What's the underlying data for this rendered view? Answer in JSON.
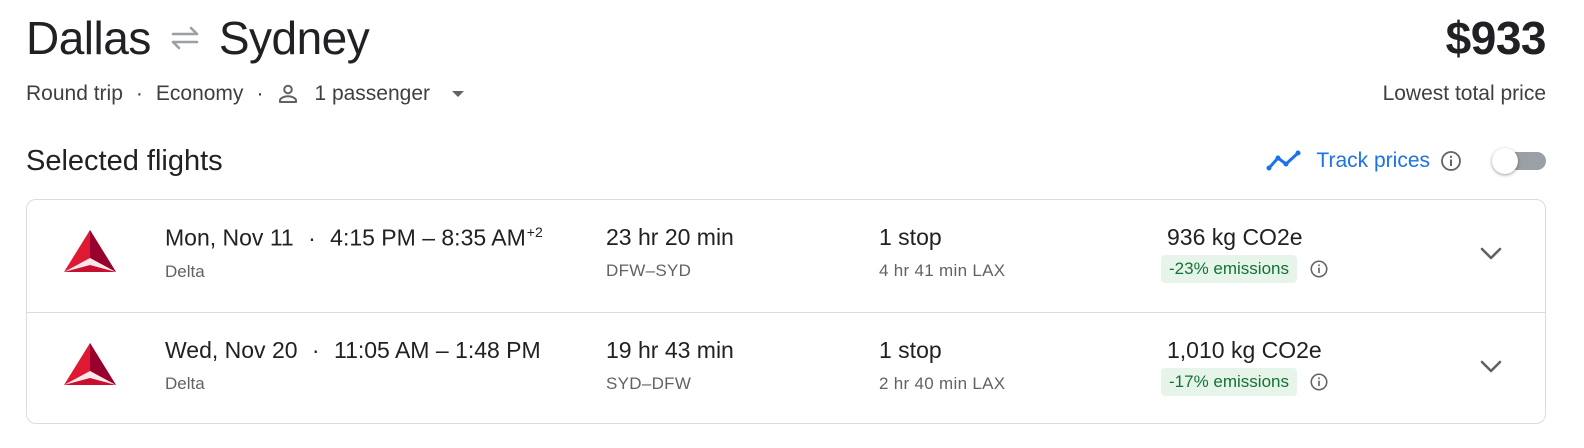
{
  "trip": {
    "origin": "Dallas",
    "destination": "Sydney",
    "price": "$933",
    "price_label": "Lowest total price",
    "trip_type": "Round trip",
    "cabin": "Economy",
    "passengers": "1 passenger",
    "separator": "·"
  },
  "section": {
    "title": "Selected flights",
    "track_label": "Track prices",
    "track_enabled": false
  },
  "flights": [
    {
      "date": "Mon, Nov 11",
      "separator": "·",
      "time_range": "4:15 PM – 8:35 AM",
      "day_offset": "+2",
      "airline": "Delta",
      "duration": "23 hr 20 min",
      "route": "DFW–SYD",
      "stops": "1 stop",
      "layover": "4 hr 41 min LAX",
      "co2": "936 kg CO2e",
      "emissions": "-23% emissions"
    },
    {
      "date": "Wed, Nov 20",
      "separator": "·",
      "time_range": "11:05 AM – 1:48 PM",
      "day_offset": "",
      "airline": "Delta",
      "duration": "19 hr 43 min",
      "route": "SYD–DFW",
      "stops": "1 stop",
      "layover": "2 hr 40 min LAX",
      "co2": "1,010 kg CO2e",
      "emissions": "-17% emissions"
    }
  ],
  "colors": {
    "accent": "#1a73e8",
    "emission_text": "#137333",
    "emission_bg": "#e6f4ea",
    "delta_red": "#e01933",
    "delta_dark": "#98002e"
  },
  "icons": {
    "swap": "swap-arrows-icon",
    "passenger": "person-icon",
    "dropdown": "dropdown-caret-icon",
    "track": "trending-line-icon",
    "info": "info-icon",
    "expand": "chevron-down-icon",
    "airline_logo": "delta-logo-icon"
  }
}
